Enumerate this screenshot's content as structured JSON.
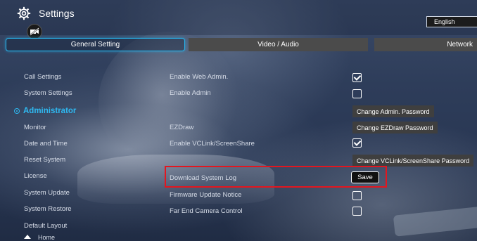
{
  "header": {
    "title": "Settings",
    "icons": {
      "settings": "gear-icon",
      "mute": "camera-off-icon"
    },
    "language": "English"
  },
  "tabs": [
    {
      "label": "General Setting",
      "active": true
    },
    {
      "label": "Video / Audio",
      "active": false
    },
    {
      "label": "Network",
      "active": false
    }
  ],
  "sidebar": {
    "items_top": [
      "Call Settings",
      "System Settings"
    ],
    "active": "Administrator",
    "items_bottom": [
      "Monitor",
      "Date and Time",
      "Reset System",
      "License",
      "System Update",
      "System Restore",
      "Default Layout"
    ],
    "home": "Home"
  },
  "settings": {
    "enable_web_admin": {
      "label": "Enable Web Admin.",
      "checked": true
    },
    "enable_admin": {
      "label": "Enable Admin",
      "checked": false
    },
    "change_admin_password": "Change Admin. Password",
    "ezdraw": {
      "label": "EZDraw"
    },
    "change_ezdraw_password": "Change EZDraw Password",
    "enable_vclink": {
      "label": "Enable VCLink/ScreenShare",
      "checked": true
    },
    "change_vclink_password": "Change VCLink/ScreenShare Password",
    "download_log": {
      "label": "Download System Log",
      "button": "Save"
    },
    "firmware_notice": {
      "label": "Firmware Update Notice",
      "checked": false
    },
    "far_end_camera": {
      "label": "Far End Camera Control",
      "checked": false
    }
  },
  "colors": {
    "accent": "#2fb8f0",
    "highlight": "#e3161f",
    "tab_inactive": "#4b4b4b"
  }
}
